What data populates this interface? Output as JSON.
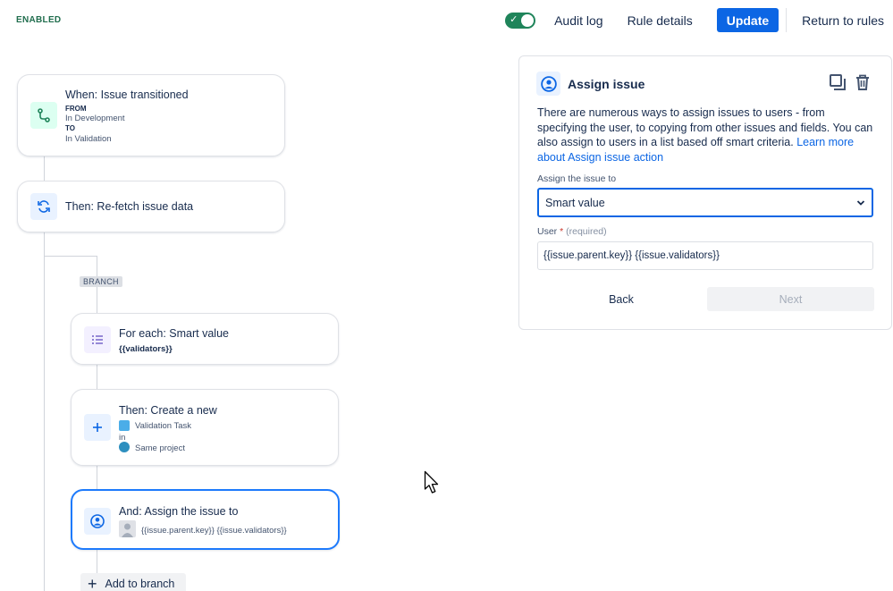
{
  "status": "ENABLED",
  "header": {
    "audit_log": "Audit log",
    "rule_details": "Rule details",
    "update": "Update",
    "return": "Return to rules"
  },
  "trigger": {
    "title": "When: Issue transitioned",
    "from_label": "FROM",
    "from_value": "In Development",
    "to_label": "TO",
    "to_value": "In Validation"
  },
  "refetch": {
    "title": "Then: Re-fetch issue data"
  },
  "branch_label": "BRANCH",
  "foreach": {
    "title": "For each: Smart value",
    "value": "{{validators}}"
  },
  "create": {
    "title": "Then: Create a new",
    "issue_type": "Validation Task",
    "in_label": "in",
    "project": "Same project"
  },
  "assign": {
    "title": "And: Assign the issue to",
    "value": "{{issue.parent.key}} {{issue.validators}}"
  },
  "add_branch": "Add to branch",
  "panel": {
    "title": "Assign issue",
    "description": "There are numerous ways to assign issues to users - from specifying the user, to copying from other issues and fields. You can also assign to users in a list based off smart criteria.",
    "learn_more": "Learn more about Assign issue action",
    "assign_label": "Assign the issue to",
    "assign_value": "Smart value",
    "user_label": "User",
    "required_mark": "*",
    "required_text": "(required)",
    "user_value": "{{issue.parent.key}} {{issue.validators}}",
    "back": "Back",
    "next": "Next"
  },
  "icons": {
    "trigger": "branch-transition-icon",
    "refetch": "refresh-icon",
    "foreach": "list-icon",
    "create": "plus-icon",
    "assign": "user-avatar-icon",
    "copy": "copy-icon",
    "delete": "trash-icon"
  },
  "colors": {
    "primary": "#0c66e4",
    "enabled": "#216e4e",
    "toggle": "#1f845a",
    "selected_border": "#1d7afc"
  }
}
